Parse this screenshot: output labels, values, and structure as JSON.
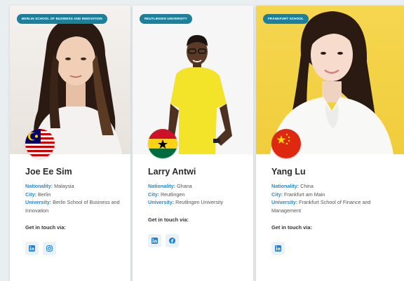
{
  "cards": [
    {
      "badge": "Berlin School of Business and Innovation",
      "name": "Joe Ee Sim",
      "nationality_label": "Nationality:",
      "nationality": "Malaysia",
      "city_label": "City:",
      "city": "Berlin",
      "university_label": "University:",
      "university": "Berlin School of Business and Innovation",
      "touch": "Get in touch via:",
      "socials": [
        "linkedin-icon",
        "instagram-icon"
      ],
      "flag": "malaysia-flag"
    },
    {
      "badge": "Reutlingen University",
      "name": "Larry Antwi",
      "nationality_label": "Nationality:",
      "nationality": "Ghana",
      "city_label": "City:",
      "city": "Reutlingen",
      "university_label": "University:",
      "university": "Reutlingen University",
      "touch": "Get in touch via:",
      "socials": [
        "linkedin-icon",
        "facebook-icon"
      ],
      "flag": "ghana-flag"
    },
    {
      "badge": "Frankfurt School",
      "name": "Yang Lu",
      "nationality_label": "Nationality:",
      "nationality": "China",
      "city_label": "City:",
      "city": "Frankfurt am Main",
      "university_label": "University:",
      "university": "Frankfurt School of Finance and Management",
      "touch": "Get in touch via:",
      "socials": [
        "linkedin-icon"
      ],
      "flag": "china-flag"
    }
  ],
  "colors": {
    "badge": "#1d7f9a",
    "label": "#2a88c9",
    "icon": "#1f7fd0"
  }
}
